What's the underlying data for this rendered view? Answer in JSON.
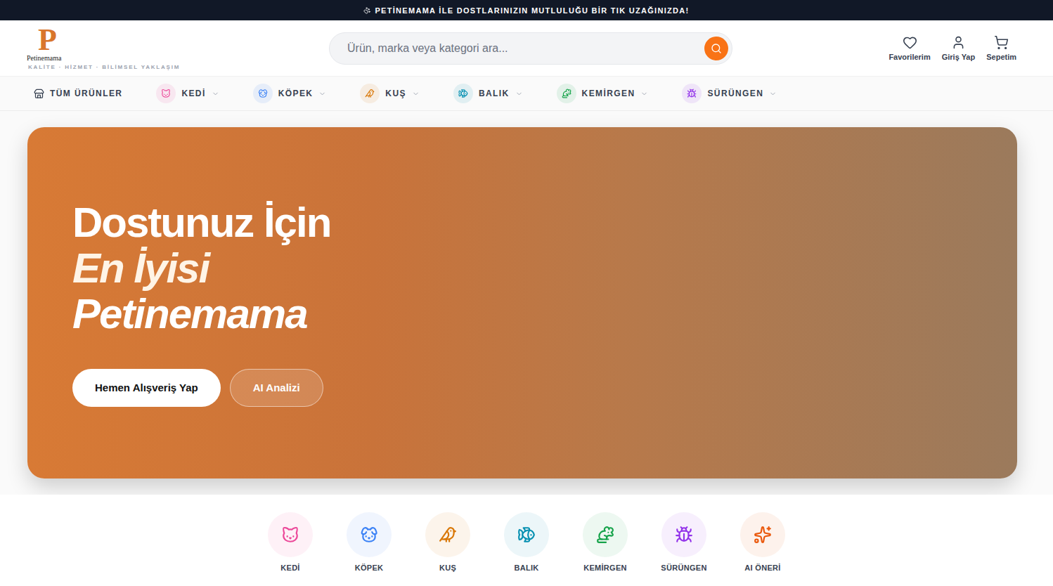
{
  "announcement": {
    "text": "PETİNEMAMA İLE DOSTLARINIZIN MUTLULUĞU BİR TIK UZAĞINIZDA!"
  },
  "logo": {
    "letter": "P",
    "name": "Petinemama",
    "tagline": "KALİTE · HİZMET · BİLİMSEL YAKLAŞIM"
  },
  "search": {
    "placeholder": "Ürün, marka veya kategori ara..."
  },
  "actions": [
    {
      "label": "Favorilerim"
    },
    {
      "label": "Giriş Yap"
    },
    {
      "label": "Sepetim"
    }
  ],
  "nav": {
    "all": "TÜM ÜRÜNLER",
    "items": [
      {
        "label": "KEDİ",
        "color": "#ec4899"
      },
      {
        "label": "KÖPEK",
        "color": "#3b82f6"
      },
      {
        "label": "KUŞ",
        "color": "#d97706"
      },
      {
        "label": "BALIK",
        "color": "#0891b2"
      },
      {
        "label": "KEMİRGEN",
        "color": "#16a34a"
      },
      {
        "label": "SÜRÜNGEN",
        "color": "#9333ea"
      }
    ]
  },
  "hero": {
    "title": "Dostunuz İçin",
    "lines": [
      "En İyisi",
      "Petinemama"
    ],
    "buttons": [
      {
        "label": "Hemen Alışveriş Yap",
        "kind": "primary"
      },
      {
        "label": "AI Analizi",
        "kind": "ghost"
      }
    ]
  },
  "categories": [
    {
      "label": "KEDİ",
      "color": "#ec4899"
    },
    {
      "label": "KÖPEK",
      "color": "#3b82f6"
    },
    {
      "label": "KUŞ",
      "color": "#d97706"
    },
    {
      "label": "BALIK",
      "color": "#0891b2"
    },
    {
      "label": "KEMİRGEN",
      "color": "#16a34a"
    },
    {
      "label": "SÜRÜNGEN",
      "color": "#9333ea"
    },
    {
      "label": "AI ÖNERİ",
      "color": "#ea580c"
    }
  ]
}
